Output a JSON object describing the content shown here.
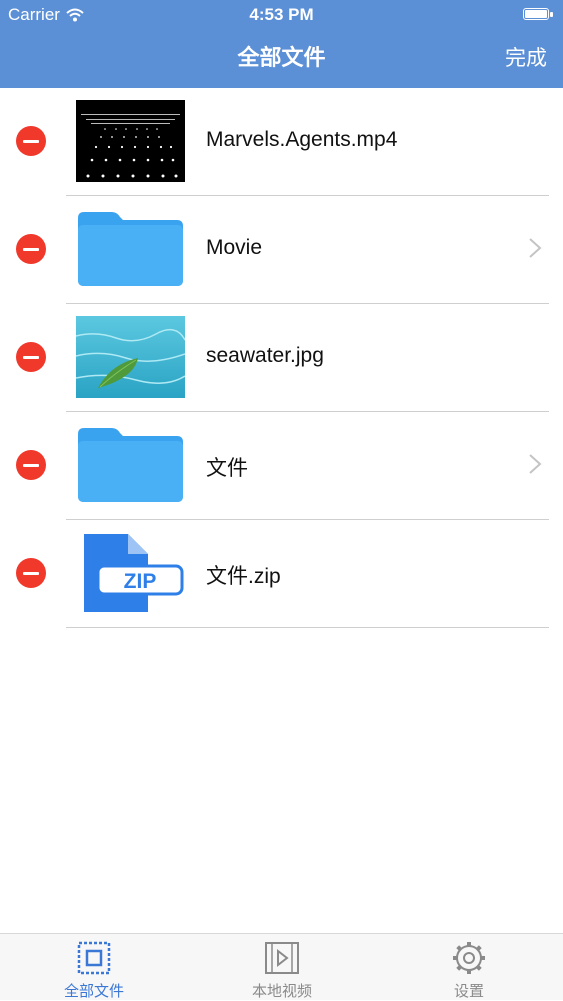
{
  "status": {
    "carrier": "Carrier",
    "time": "4:53 PM"
  },
  "nav": {
    "title": "全部文件",
    "done_label": "完成"
  },
  "files": [
    {
      "name": "Marvels.Agents.mp4",
      "type": "video-thumbnail"
    },
    {
      "name": "Movie",
      "type": "folder-icon"
    },
    {
      "name": "seawater.jpg",
      "type": "image-thumbnail"
    },
    {
      "name": "文件",
      "type": "folder-icon"
    },
    {
      "name": "文件.zip",
      "type": "zip-icon"
    }
  ],
  "tabs": [
    {
      "label": "全部文件",
      "icon": "all-files-icon",
      "active": true
    },
    {
      "label": "本地视频",
      "icon": "video-icon",
      "active": false
    },
    {
      "label": "设置",
      "icon": "gear-icon",
      "active": false
    }
  ],
  "colors": {
    "nav_bar": "#5b8fd6",
    "delete": "#f0392b",
    "folder": "#3aa3f0",
    "tab_active": "#3b78d6"
  }
}
